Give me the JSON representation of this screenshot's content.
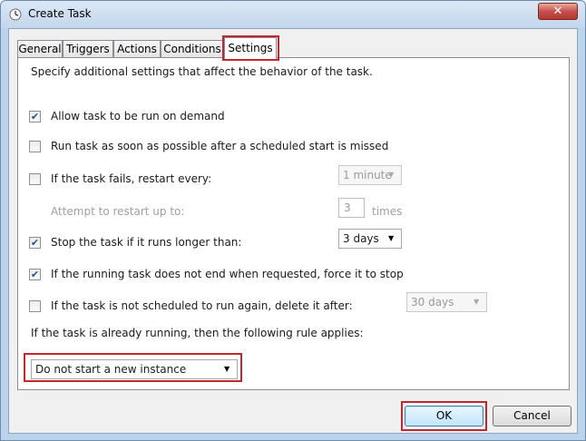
{
  "window": {
    "title": "Create Task",
    "close_glyph": "✕"
  },
  "tabs": [
    {
      "label": "General"
    },
    {
      "label": "Triggers"
    },
    {
      "label": "Actions"
    },
    {
      "label": "Conditions"
    },
    {
      "label": "Settings",
      "active": true
    }
  ],
  "settings": {
    "description": "Specify additional settings that affect the behavior of the task.",
    "allow_on_demand": {
      "label": "Allow task to be run on demand",
      "checked": true
    },
    "run_asap": {
      "label": "Run task as soon as possible after a scheduled start is missed",
      "checked": false
    },
    "restart_on_fail": {
      "label": "If the task fails, restart every:",
      "checked": false,
      "interval": "1 minute"
    },
    "attempt_restart": {
      "label": "Attempt to restart up to:",
      "count": "3",
      "unit": "times"
    },
    "stop_if_long": {
      "label": "Stop the task if it runs longer than:",
      "checked": true,
      "duration": "3 days"
    },
    "force_stop": {
      "label": "If the running task does not end when requested, force it to stop",
      "checked": true
    },
    "delete_after": {
      "label": "If the task is not scheduled to run again, delete it after:",
      "checked": false,
      "duration": "30 days"
    },
    "rule_label": "If the task is already running, then the following rule applies:",
    "rule_value": "Do not start a new instance"
  },
  "buttons": {
    "ok": "OK",
    "cancel": "Cancel"
  },
  "glyphs": {
    "check": "✔",
    "arrow": "▼"
  },
  "colors": {
    "highlight": "#c0282e",
    "checkmark": "#2b4f8a"
  }
}
